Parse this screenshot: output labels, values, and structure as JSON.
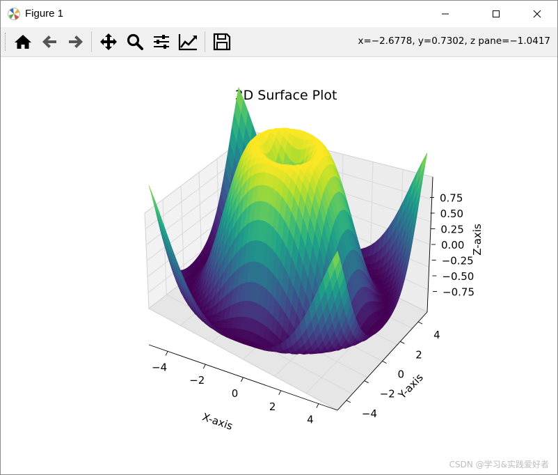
{
  "window": {
    "title": "Figure 1"
  },
  "toolbar": {
    "buttons": [
      {
        "name": "home-icon",
        "tip": "Home"
      },
      {
        "name": "back-arrow-icon",
        "tip": "Back"
      },
      {
        "name": "forward-arrow-icon",
        "tip": "Forward"
      },
      {
        "name": "pan-move-icon",
        "tip": "Pan"
      },
      {
        "name": "zoom-magnifier-icon",
        "tip": "Zoom"
      },
      {
        "name": "subplots-sliders-icon",
        "tip": "Subplots"
      },
      {
        "name": "edit-axes-chart-icon",
        "tip": "Customize"
      },
      {
        "name": "save-floppy-icon",
        "tip": "Save"
      }
    ],
    "coord_readout": "x=−2.6778, y=0.7302, z pane=−1.0417"
  },
  "plot": {
    "title": "3D Surface Plot",
    "xlabel": "X-axis",
    "ylabel": "Y-axis",
    "zlabel": "Z-axis",
    "x_ticks": [
      "−4",
      "−2",
      "0",
      "2",
      "4"
    ],
    "y_ticks": [
      "−4",
      "−2",
      "0",
      "2",
      "4"
    ],
    "z_ticks": [
      "0.75",
      "0.50",
      "0.25",
      "0.00",
      "−0.25",
      "−0.50",
      "−0.75"
    ]
  },
  "chart_data": {
    "type": "surface",
    "function": "sin(sqrt(x^2 + y^2))",
    "x_range": [
      -5,
      5
    ],
    "y_range": [
      -5,
      5
    ],
    "z_range": [
      -1,
      1
    ],
    "colormap": "viridis",
    "title": "3D Surface Plot",
    "xlabel": "X-axis",
    "ylabel": "Y-axis",
    "zlabel": "Z-axis"
  },
  "watermark": "CSDN @学习&实践爱好者",
  "colors": {
    "toolbar_bg": "#f0f0f0",
    "pane": "#f2f2f2",
    "grid": "#d8d8d8"
  }
}
